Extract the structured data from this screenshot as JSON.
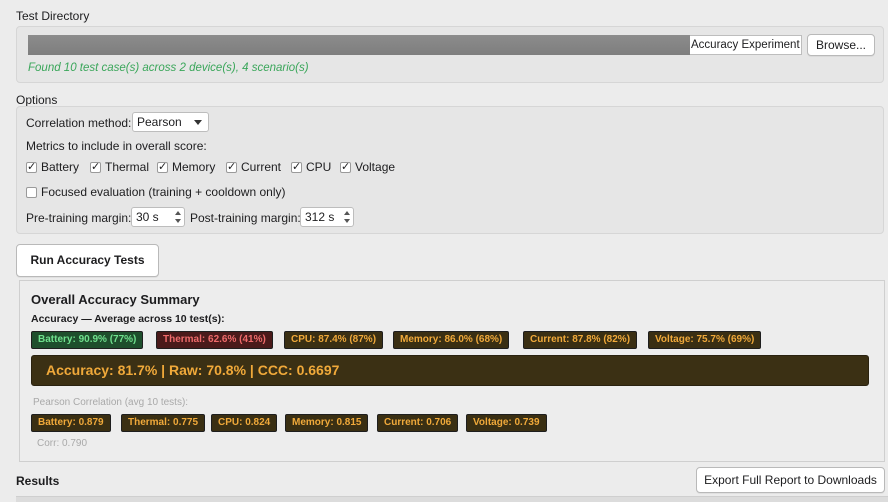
{
  "test_directory": {
    "title": "Test Directory",
    "path_value": "Accuracy Experiment",
    "browse_label": "Browse...",
    "found_text": "Found 10 test case(s) across 2 device(s), 4 scenario(s)"
  },
  "options": {
    "title": "Options",
    "correlation_label": "Correlation method:",
    "correlation_value": "Pearson",
    "metrics_label": "Metrics to include in overall score:",
    "metrics": [
      {
        "label": "Battery",
        "checked": true
      },
      {
        "label": "Thermal",
        "checked": true
      },
      {
        "label": "Memory",
        "checked": true
      },
      {
        "label": "Current",
        "checked": true
      },
      {
        "label": "CPU",
        "checked": true
      },
      {
        "label": "Voltage",
        "checked": true
      }
    ],
    "focused_label": "Focused evaluation (training + cooldown only)",
    "focused_checked": false,
    "pre_margin_label": "Pre-training margin:",
    "pre_margin_value": "30 s",
    "post_margin_label": "Post-training margin:",
    "post_margin_value": "312 s"
  },
  "run_button_label": "Run Accuracy Tests",
  "summary": {
    "title": "Overall Accuracy Summary",
    "subtitle": "Accuracy — Average across 10 test(s):",
    "accuracy_badges": [
      {
        "text": "Battery: 90.9% (77%)",
        "style": "green"
      },
      {
        "text": "Thermal: 62.6% (41%)",
        "style": "red"
      },
      {
        "text": "CPU: 87.4% (87%)",
        "style": "gold"
      },
      {
        "text": "Memory: 86.0% (68%)",
        "style": "gold"
      },
      {
        "text": "Current: 87.8% (82%)",
        "style": "gold"
      },
      {
        "text": "Voltage: 75.7% (69%)",
        "style": "gold"
      }
    ],
    "banner": "Accuracy: 81.7%  |  Raw: 70.8%  |  CCC: 0.6697",
    "pearson_label": "Pearson Correlation (avg 10 tests):",
    "pearson_badges": [
      "Battery: 0.879",
      "Thermal: 0.775",
      "CPU: 0.824",
      "Memory: 0.815",
      "Current: 0.706",
      "Voltage: 0.739"
    ],
    "corr_text": "Corr: 0.790"
  },
  "results": {
    "title": "Results",
    "export_label": "Export Full Report to Downloads"
  },
  "colors": {
    "badge_gold_bg": "#3a2f13",
    "badge_gold_text": "#f0a93a",
    "badge_green_bg": "#1e4e2c",
    "badge_green_text": "#6fe08d",
    "badge_red_bg": "#4a1a1a",
    "badge_red_text": "#ef6b6b",
    "found_text": "#3aa65a"
  }
}
